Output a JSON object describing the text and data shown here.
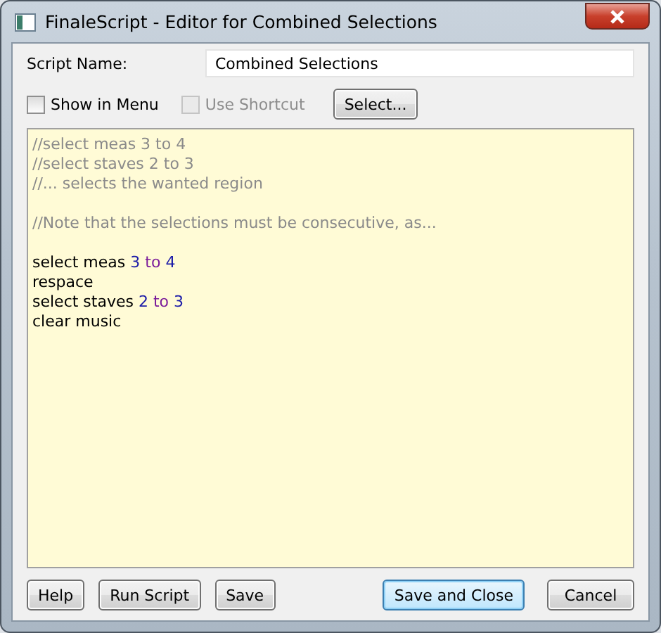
{
  "window": {
    "title": "FinaleScript - Editor for Combined Selections"
  },
  "script_name": {
    "label": "Script Name:",
    "value": "Combined Selections"
  },
  "options": [
    {
      "label": "Show in Menu",
      "checked": false,
      "disabled": false
    },
    {
      "label": "Use Shortcut",
      "checked": false,
      "disabled": true
    }
  ],
  "select_button": "Select...",
  "editor": {
    "blocks": [
      {
        "lines": [
          [
            {
              "text": "//select meas 3 to 4",
              "kind": "comment"
            }
          ],
          [
            {
              "text": "//select staves 2 to 3",
              "kind": "comment"
            }
          ],
          [
            {
              "text": "//... selects the wanted region",
              "kind": "comment"
            }
          ]
        ]
      },
      {
        "lines": [
          [
            {
              "text": "//Note that the selections must be consecutive, as...",
              "kind": "comment"
            }
          ]
        ]
      },
      {
        "lines": [
          [
            {
              "text": "select meas ",
              "kind": "plain"
            },
            {
              "text": "3",
              "kind": "number"
            },
            {
              "text": " to ",
              "kind": "keyword"
            },
            {
              "text": "4",
              "kind": "number"
            }
          ],
          [
            {
              "text": "respace",
              "kind": "plain"
            }
          ],
          [
            {
              "text": "select staves ",
              "kind": "plain"
            },
            {
              "text": "2",
              "kind": "number"
            },
            {
              "text": " to ",
              "kind": "keyword"
            },
            {
              "text": "3",
              "kind": "number"
            }
          ],
          [
            {
              "text": "clear music",
              "kind": "plain"
            }
          ]
        ]
      }
    ]
  },
  "buttons": [
    {
      "label": "Help",
      "kind": "left",
      "default": false
    },
    {
      "label": "Run Script",
      "kind": "left",
      "default": false
    },
    {
      "label": "Save",
      "kind": "left",
      "default": false
    },
    {
      "label": "Save and Close",
      "kind": "right",
      "default": true
    },
    {
      "label": "Cancel",
      "kind": "right",
      "default": false
    }
  ]
}
